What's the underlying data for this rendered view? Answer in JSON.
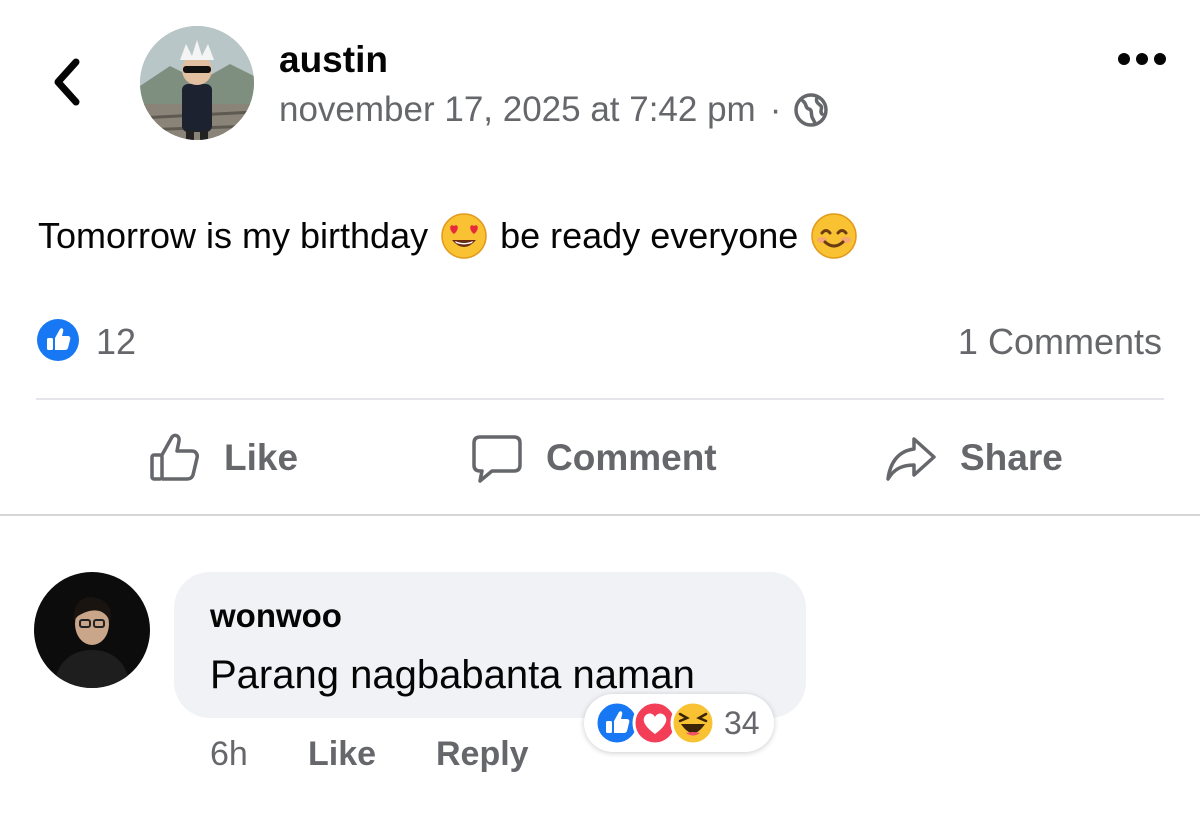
{
  "post": {
    "author": "austin",
    "timestamp": "november 17, 2025 at 7:42 pm",
    "separator": "·",
    "privacy_icon": "globe-icon",
    "text_part1": "Tomorrow is my birthday",
    "text_part2": "be ready everyone",
    "emoji1": "heart-eyes-emoji",
    "emoji2": "smiling-face-emoji",
    "like_count": "12",
    "comments_label": "1 Comments"
  },
  "actions": {
    "like": "Like",
    "comment": "Comment",
    "share": "Share"
  },
  "comment": {
    "author": "wonwoo",
    "text": "Parang nagbabanta naman",
    "time": "6h",
    "like": "Like",
    "reply": "Reply",
    "reaction_icons": [
      "like-icon",
      "love-icon",
      "haha-icon"
    ],
    "reaction_count": "34"
  },
  "colors": {
    "accent_blue": "#1877f2",
    "love_red": "#f33e58",
    "text_secondary": "#65676b",
    "bubble_bg": "#f0f2f5"
  }
}
